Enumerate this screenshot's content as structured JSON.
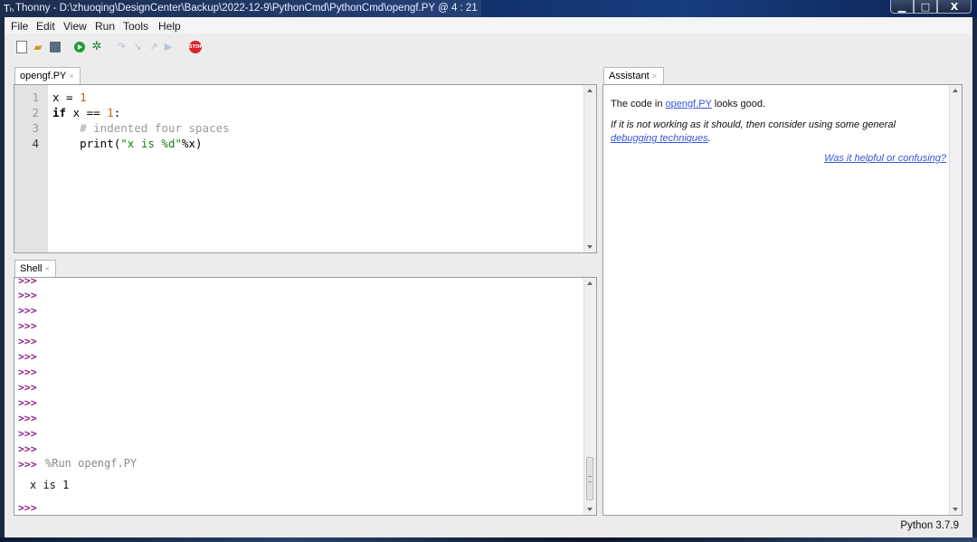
{
  "window": {
    "title": "Thonny  -  D:\\zhuoqing\\DesignCenter\\Backup\\2022-12-9\\PythonCmd\\PythonCmd\\opengf.PY  @  4 : 21",
    "app_icon": "Tₕ",
    "min_icon": "minimize-icon",
    "max_icon": "maximize-icon",
    "close_icon": "close-icon",
    "min_glyph": "▁",
    "max_glyph": "□",
    "close_glyph": "X"
  },
  "menu": {
    "items": [
      "File",
      "Edit",
      "View",
      "Run",
      "Tools",
      "Help"
    ]
  },
  "toolbar": {
    "icons": [
      "new-file-icon",
      "open-folder-icon",
      "save-icon",
      "run-icon",
      "debug-icon",
      "step-over-icon",
      "step-into-icon",
      "step-out-icon",
      "resume-icon",
      "stop-icon"
    ],
    "stop_label": "STOP"
  },
  "editor": {
    "tab_label": "opengf.PY",
    "tab_close": "×",
    "line_numbers": [
      "1",
      "2",
      "3",
      "4"
    ],
    "lines": [
      {
        "parts": [
          "x = ",
          "1"
        ]
      },
      {
        "parts": [
          "if",
          " x == ",
          "1",
          ":"
        ]
      },
      {
        "parts": [
          "    ",
          "# indented four spaces"
        ]
      },
      {
        "parts": [
          "    print(",
          "\"x is %d\"",
          "%x)"
        ]
      }
    ]
  },
  "shell": {
    "tab_label": "Shell",
    "tab_close": "×",
    "prompt": ">>>",
    "run_command": "%Run opengf.PY",
    "output": "x is 1"
  },
  "assistant": {
    "tab_label": "Assistant",
    "tab_close": "×",
    "line1_prefix": "The code in ",
    "line1_link": "opengf.PY",
    "line1_suffix": " looks good.",
    "line2_text": "If it is not working as it should, then consider using some general",
    "line2_link": "debugging techniques",
    "line2_end": ".",
    "feedback_link": "Was it helpful or confusing?"
  },
  "status": {
    "interpreter": "Python 3.7.9"
  },
  "colors": {
    "prompt": "#8a1f8a",
    "keyword_number": "#c8620c",
    "string": "#1f7a1f",
    "comment": "#9a9a9a",
    "link": "#3655d8"
  }
}
